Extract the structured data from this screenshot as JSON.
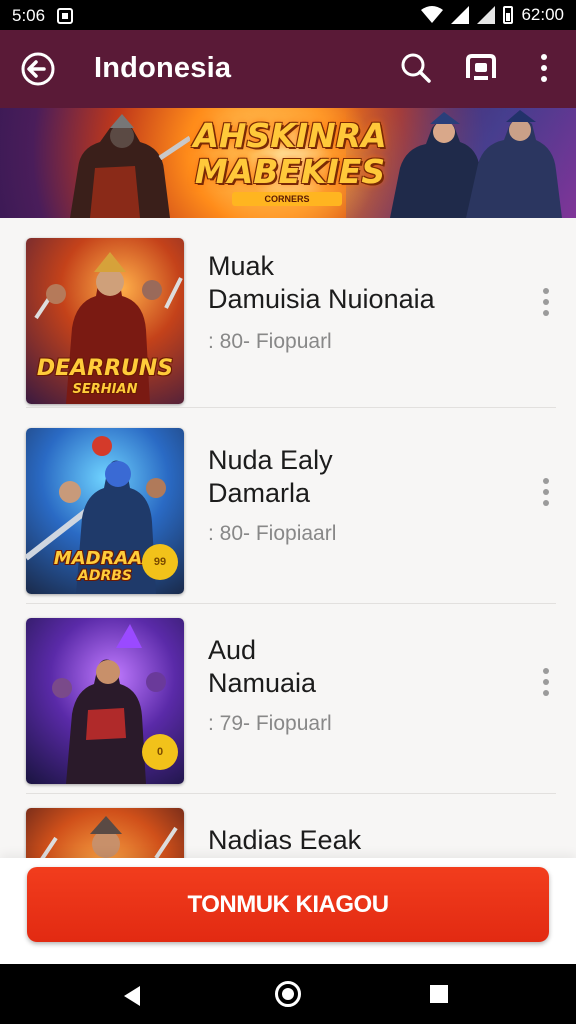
{
  "status_bar": {
    "left_text": "5:06",
    "time": "62:00",
    "icons": [
      "notification-icon",
      "wifi-icon",
      "signal-icon",
      "battery-icon"
    ]
  },
  "app_bar": {
    "title": "Indonesia",
    "back_icon": "back-arrow-icon",
    "actions": [
      "search-icon",
      "cast-icon",
      "more-vert-icon"
    ],
    "background": "#5a1a37"
  },
  "banner": {
    "title_line1": "AHSKINRA",
    "title_line2": "MABEKIES",
    "subtitle": "CORNERS"
  },
  "list": {
    "items": [
      {
        "title_line1": "Muak",
        "title_line2": "Damuisia Nuionaia",
        "meta": ": 80- Fiopuarl",
        "thumb_label_line1": "DEARRUNS",
        "thumb_label_line2": "SERHIAN",
        "badge": ""
      },
      {
        "title_line1": "Nuda Ealy",
        "title_line2": "Damarla",
        "meta": ": 80- Fiopiaarl",
        "thumb_label_line1": "MADRAAA",
        "thumb_label_line2": "ADRBS",
        "badge": "99"
      },
      {
        "title_line1": "Aud",
        "title_line2": "Namuaia",
        "meta": ": 79- Fiopuarl",
        "thumb_label_line1": "",
        "thumb_label_line2": "",
        "badge": "0"
      },
      {
        "title_line1": "Nadias Eeak",
        "title_line2": "",
        "meta": "",
        "thumb_label_line1": "",
        "thumb_label_line2": "",
        "badge": ""
      }
    ]
  },
  "primary_action": {
    "label": "TONMUK KIAGOU",
    "color": "#e62e15"
  },
  "nav_bar": {
    "buttons": [
      "back-triangle-icon",
      "home-circle-icon",
      "recents-square-icon"
    ]
  }
}
